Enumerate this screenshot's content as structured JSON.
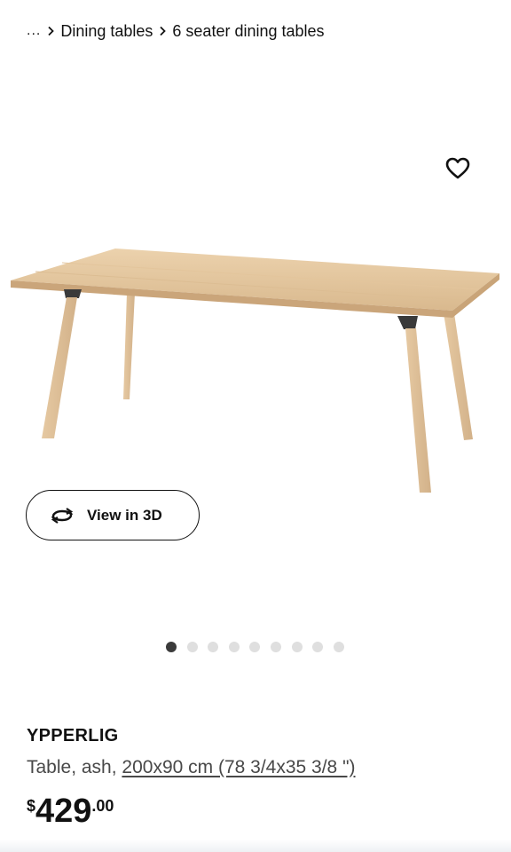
{
  "breadcrumb": {
    "ellipsis": "...",
    "items": [
      "Dining tables",
      "6 seater dining tables"
    ]
  },
  "favorite": {
    "icon": "heart-outline-icon"
  },
  "view3d": {
    "label": "View in 3D",
    "icon": "rotate-3d-icon"
  },
  "carousel": {
    "total": 9,
    "active_index": 0
  },
  "product": {
    "name": "YPPERLIG",
    "description_prefix": "Table, ash, ",
    "size": "200x90 cm (78 3/4x35 3/8 \")",
    "price_currency": "$",
    "price_integer": "429",
    "price_decimal": ".00"
  },
  "colors": {
    "text": "#111111",
    "muted": "#484848",
    "dot_active": "#3b3b3b",
    "dot": "#dfdfdf"
  }
}
